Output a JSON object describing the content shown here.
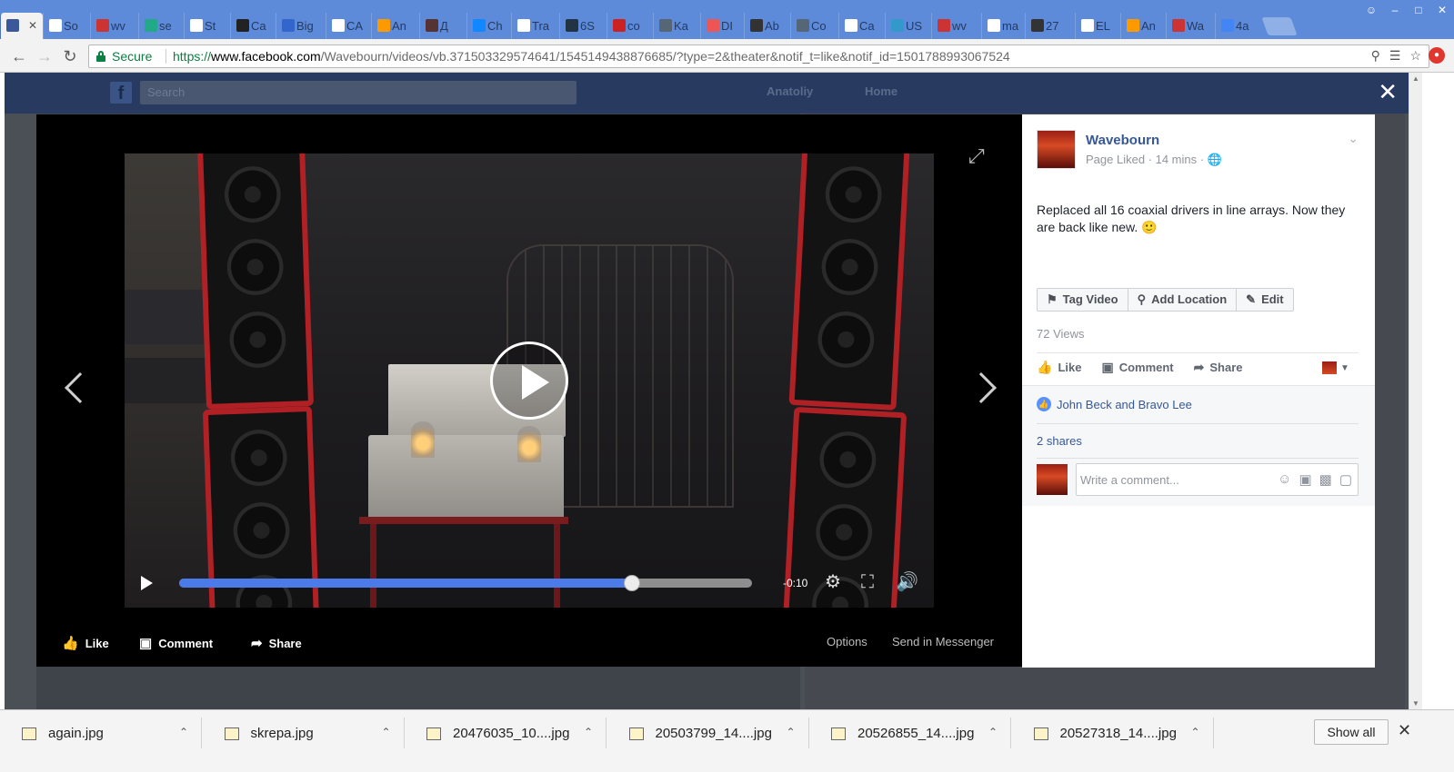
{
  "browser": {
    "tabs": [
      {
        "label": "",
        "favicon_color": "#3b5998",
        "active": true
      },
      {
        "label": "So",
        "favicon_color": "#ffffff"
      },
      {
        "label": "wv",
        "favicon_color": "#c33"
      },
      {
        "label": "se",
        "favicon_color": "#2a8"
      },
      {
        "label": "St",
        "favicon_color": "#ffffff"
      },
      {
        "label": "Ca",
        "favicon_color": "#222"
      },
      {
        "label": "Big",
        "favicon_color": "#36c"
      },
      {
        "label": "CA",
        "favicon_color": "#ffffff"
      },
      {
        "label": "An",
        "favicon_color": "#f90"
      },
      {
        "label": "Д",
        "favicon_color": "#533"
      },
      {
        "label": "Ch",
        "favicon_color": "#18f"
      },
      {
        "label": "Tra",
        "favicon_color": "#ffffff"
      },
      {
        "label": "6S",
        "favicon_color": "#234"
      },
      {
        "label": "co",
        "favicon_color": "#c22"
      },
      {
        "label": "Ka",
        "favicon_color": "#567"
      },
      {
        "label": "DI",
        "favicon_color": "#e55"
      },
      {
        "label": "Ab",
        "favicon_color": "#333"
      },
      {
        "label": "Co",
        "favicon_color": "#567"
      },
      {
        "label": "Ca",
        "favicon_color": "#ffffff"
      },
      {
        "label": "US",
        "favicon_color": "#39c"
      },
      {
        "label": "wv",
        "favicon_color": "#c33"
      },
      {
        "label": "ma",
        "favicon_color": "#ffffff"
      },
      {
        "label": "27",
        "favicon_color": "#333"
      },
      {
        "label": "EL",
        "favicon_color": "#ffffff"
      },
      {
        "label": "An",
        "favicon_color": "#f90"
      },
      {
        "label": "Wa",
        "favicon_color": "#c33"
      },
      {
        "label": "4a",
        "favicon_color": "#4285f4"
      }
    ],
    "secure_label": "Secure",
    "url_scheme": "https://",
    "url_host": "www.facebook.com",
    "url_path": "/Wavebourn/videos/vb.371503329574641/1545149438876685/?type=2&theater&notif_t=like&notif_id=1501788993067524"
  },
  "fb": {
    "search_placeholder": "Search",
    "user_name": "Anatoliy",
    "home_label": "Home"
  },
  "video": {
    "time_remaining": "-0:10",
    "progress_fraction": 0.79
  },
  "stage_actions": {
    "like": "Like",
    "comment": "Comment",
    "share": "Share",
    "options": "Options",
    "send": "Send in Messenger"
  },
  "post": {
    "author": "Wavebourn",
    "meta": "Page Liked · 14 mins ·",
    "text": "Replaced all 16 coaxial drivers in line arrays. Now they are back like new. 🙂",
    "tag_video": "Tag Video",
    "add_location": "Add Location",
    "edit": "Edit",
    "views": "72 Views",
    "like": "Like",
    "comment": "Comment",
    "share": "Share",
    "likers": "John Beck and Bravo Lee",
    "shares": "2 shares",
    "comment_placeholder": "Write a comment..."
  },
  "downloads": {
    "items": [
      {
        "name": "again.jpg"
      },
      {
        "name": "skrepa.jpg"
      },
      {
        "name": "20476035_10....jpg"
      },
      {
        "name": "20503799_14....jpg"
      },
      {
        "name": "20526855_14....jpg"
      },
      {
        "name": "20527318_14....jpg"
      }
    ],
    "show_all": "Show all"
  },
  "colors": {
    "fb_blue": "#365899",
    "progress": "#4a7be8",
    "secure_green": "#0b8043",
    "speaker_red": "#b02024"
  }
}
